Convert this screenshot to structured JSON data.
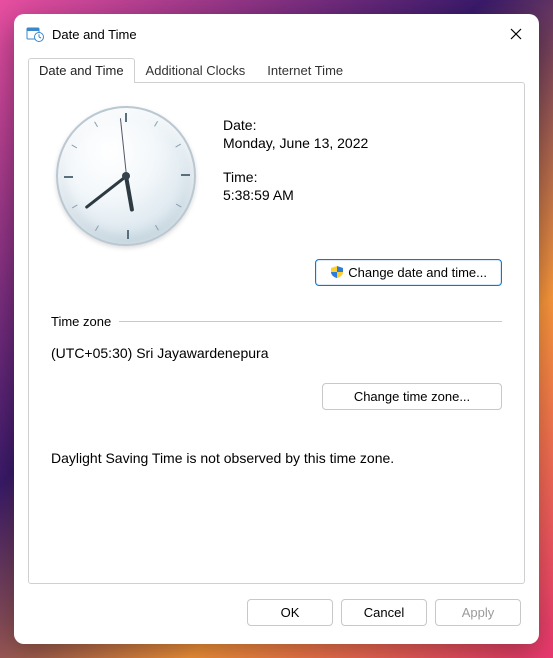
{
  "window": {
    "title": "Date and Time"
  },
  "tabs": {
    "items": [
      {
        "label": "Date and Time"
      },
      {
        "label": "Additional Clocks"
      },
      {
        "label": "Internet Time"
      }
    ]
  },
  "datetime": {
    "date_label": "Date:",
    "date_value": "Monday, June 13, 2022",
    "time_label": "Time:",
    "time_value": "5:38:59 AM",
    "change_button": "Change date and time..."
  },
  "timezone": {
    "group_label": "Time zone",
    "value": "(UTC+05:30) Sri Jayawardenepura",
    "change_button": "Change time zone...",
    "dst_note": "Daylight Saving Time is not observed by this time zone."
  },
  "footer": {
    "ok": "OK",
    "cancel": "Cancel",
    "apply": "Apply"
  }
}
